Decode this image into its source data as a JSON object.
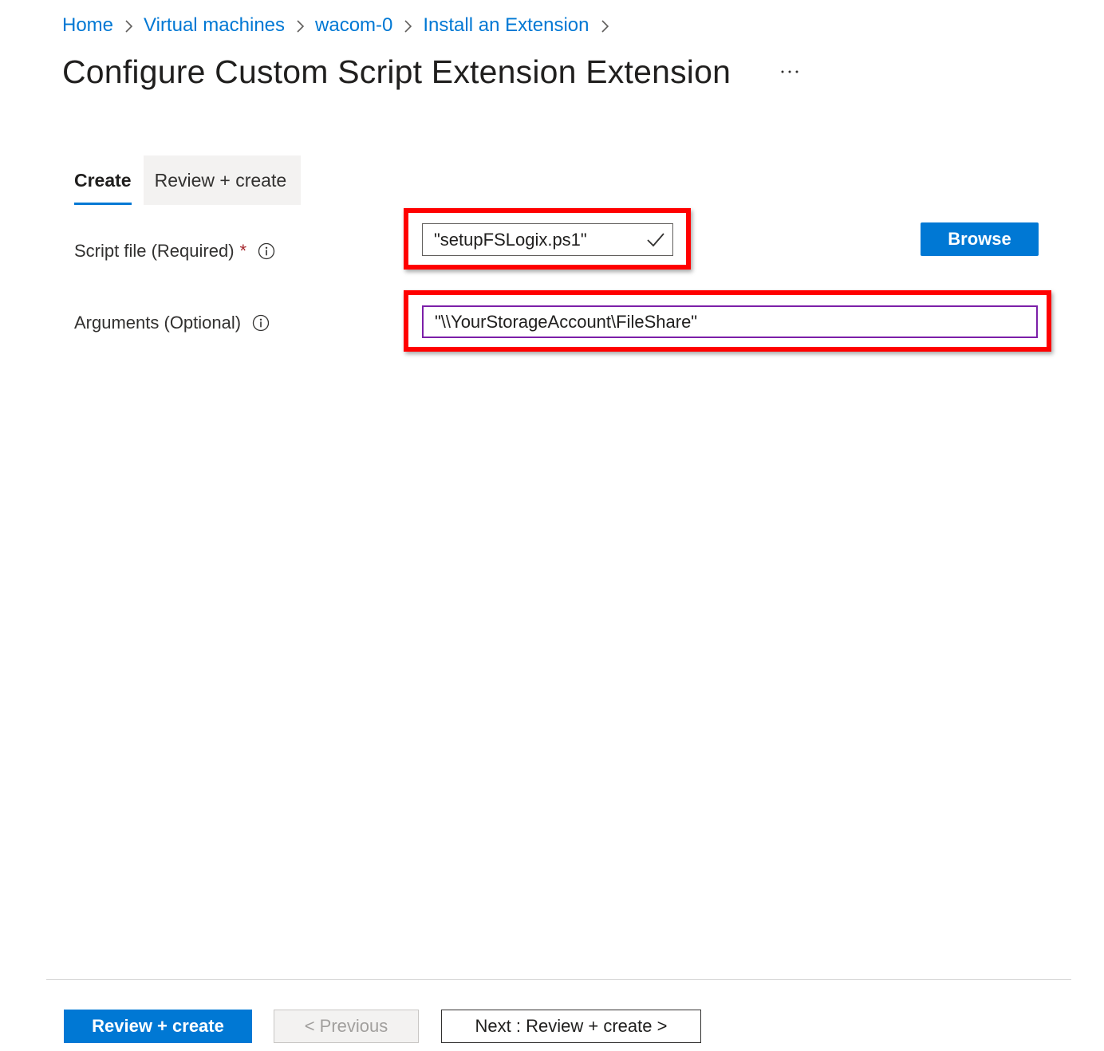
{
  "breadcrumb": {
    "items": [
      {
        "label": "Home"
      },
      {
        "label": "Virtual machines"
      },
      {
        "label": "wacom-0"
      },
      {
        "label": "Install an Extension"
      }
    ],
    "separator_icon": "chevron-right-icon"
  },
  "page": {
    "title": "Configure Custom Script Extension Extension",
    "more_icon": "more-ellipsis-icon"
  },
  "tabs": [
    {
      "label": "Create",
      "selected": true
    },
    {
      "label": "Review + create",
      "selected": false
    }
  ],
  "form": {
    "script_file": {
      "label": "Script file (Required)",
      "required_marker": "*",
      "info_icon": "info-icon",
      "value": "\"setupFSLogix.ps1\"",
      "valid": true,
      "status_icon": "checkmark-icon",
      "browse_label": "Browse"
    },
    "arguments": {
      "label": "Arguments (Optional)",
      "info_icon": "info-icon",
      "value": "\"\\\\YourStorageAccount\\FileShare\""
    }
  },
  "footer": {
    "review_create_label": "Review + create",
    "previous_label": "< Previous",
    "next_label": "Next : Review + create >"
  },
  "colors": {
    "accent": "#0078d4",
    "highlight": "#ff0000",
    "required": "#a4262c"
  }
}
